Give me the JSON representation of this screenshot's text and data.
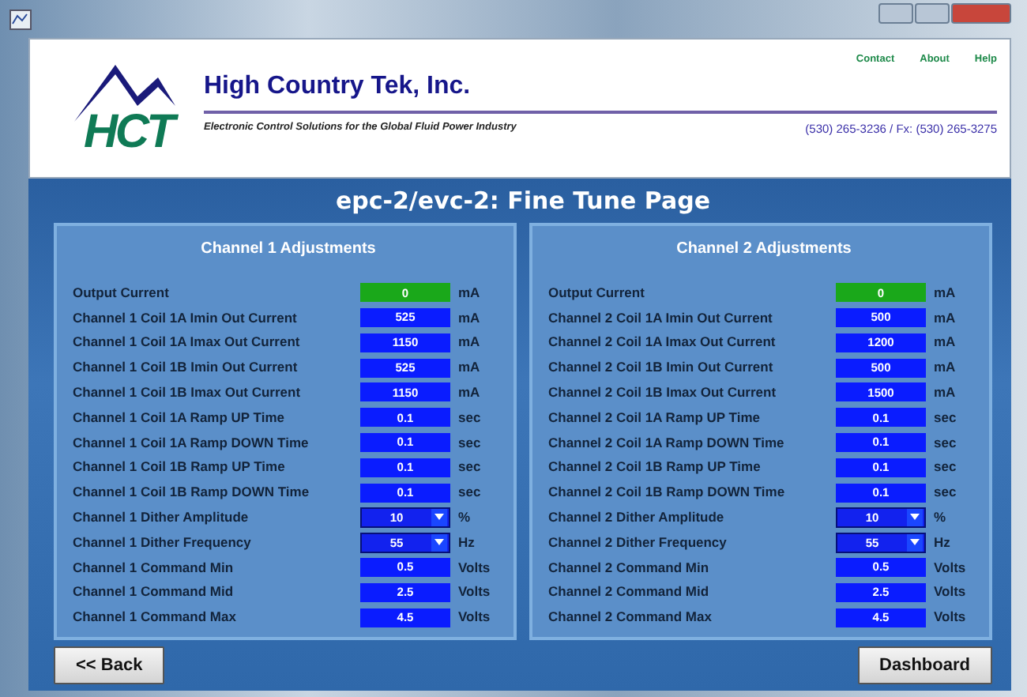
{
  "header": {
    "company": "High Country Tek, Inc.",
    "tagline": "Electronic Control Solutions for the Global Fluid Power Industry",
    "phone": "(530) 265-3236 / Fx: (530) 265-3275",
    "links": [
      "Contact",
      "About",
      "Help"
    ],
    "logo_text": "HCT"
  },
  "page_title": "epc-2/evc-2: Fine Tune Page",
  "panels": [
    {
      "title": "Channel 1 Adjustments",
      "rows": [
        {
          "label": "Output Current",
          "kind": "readout",
          "value": "0",
          "unit": "mA"
        },
        {
          "label": "Channel 1 Coil 1A Imin Out Current",
          "kind": "input",
          "value": "525",
          "unit": "mA"
        },
        {
          "label": "Channel 1 Coil 1A Imax Out Current",
          "kind": "input",
          "value": "1150",
          "unit": "mA"
        },
        {
          "label": "Channel 1 Coil 1B Imin Out Current",
          "kind": "input",
          "value": "525",
          "unit": "mA"
        },
        {
          "label": "Channel 1 Coil 1B Imax Out Current",
          "kind": "input",
          "value": "1150",
          "unit": "mA"
        },
        {
          "label": "Channel 1 Coil 1A Ramp UP Time",
          "kind": "input",
          "value": "0.1",
          "unit": "sec"
        },
        {
          "label": "Channel 1 Coil 1A Ramp DOWN Time",
          "kind": "input",
          "value": "0.1",
          "unit": "sec"
        },
        {
          "label": "Channel 1 Coil 1B Ramp UP Time",
          "kind": "input",
          "value": "0.1",
          "unit": "sec"
        },
        {
          "label": "Channel 1 Coil 1B Ramp DOWN Time",
          "kind": "input",
          "value": "0.1",
          "unit": "sec"
        },
        {
          "label": "Channel 1 Dither Amplitude",
          "kind": "dropdown",
          "value": "10",
          "unit": "%"
        },
        {
          "label": "Channel 1 Dither Frequency",
          "kind": "dropdown",
          "value": "55",
          "unit": "Hz"
        },
        {
          "label": "Channel 1 Command Min",
          "kind": "input",
          "value": "0.5",
          "unit": "Volts"
        },
        {
          "label": "Channel 1 Command Mid",
          "kind": "input",
          "value": "2.5",
          "unit": "Volts"
        },
        {
          "label": "Channel 1 Command Max",
          "kind": "input",
          "value": "4.5",
          "unit": "Volts"
        }
      ]
    },
    {
      "title": "Channel 2 Adjustments",
      "rows": [
        {
          "label": "Output Current",
          "kind": "readout",
          "value": "0",
          "unit": "mA"
        },
        {
          "label": "Channel 2 Coil 1A Imin Out Current",
          "kind": "input",
          "value": "500",
          "unit": "mA"
        },
        {
          "label": "Channel 2 Coil 1A Imax Out Current",
          "kind": "input",
          "value": "1200",
          "unit": "mA"
        },
        {
          "label": "Channel 2 Coil 1B Imin Out Current",
          "kind": "input",
          "value": "500",
          "unit": "mA"
        },
        {
          "label": "Channel 2 Coil 1B Imax Out Current",
          "kind": "input",
          "value": "1500",
          "unit": "mA"
        },
        {
          "label": "Channel 2 Coil 1A Ramp UP Time",
          "kind": "input",
          "value": "0.1",
          "unit": "sec"
        },
        {
          "label": "Channel 2 Coil 1A Ramp DOWN Time",
          "kind": "input",
          "value": "0.1",
          "unit": "sec"
        },
        {
          "label": "Channel 2 Coil 1B Ramp UP Time",
          "kind": "input",
          "value": "0.1",
          "unit": "sec"
        },
        {
          "label": "Channel 2 Coil 1B Ramp DOWN Time",
          "kind": "input",
          "value": "0.1",
          "unit": "sec"
        },
        {
          "label": "Channel 2 Dither Amplitude",
          "kind": "dropdown",
          "value": "10",
          "unit": "%"
        },
        {
          "label": "Channel 2 Dither Frequency",
          "kind": "dropdown",
          "value": "55",
          "unit": "Hz"
        },
        {
          "label": "Channel 2 Command Min",
          "kind": "input",
          "value": "0.5",
          "unit": "Volts"
        },
        {
          "label": "Channel 2 Command Mid",
          "kind": "input",
          "value": "2.5",
          "unit": "Volts"
        },
        {
          "label": "Channel 2 Command Max",
          "kind": "input",
          "value": "4.5",
          "unit": "Volts"
        }
      ]
    }
  ],
  "buttons": {
    "back": "<< Back",
    "dashboard": "Dashboard"
  }
}
